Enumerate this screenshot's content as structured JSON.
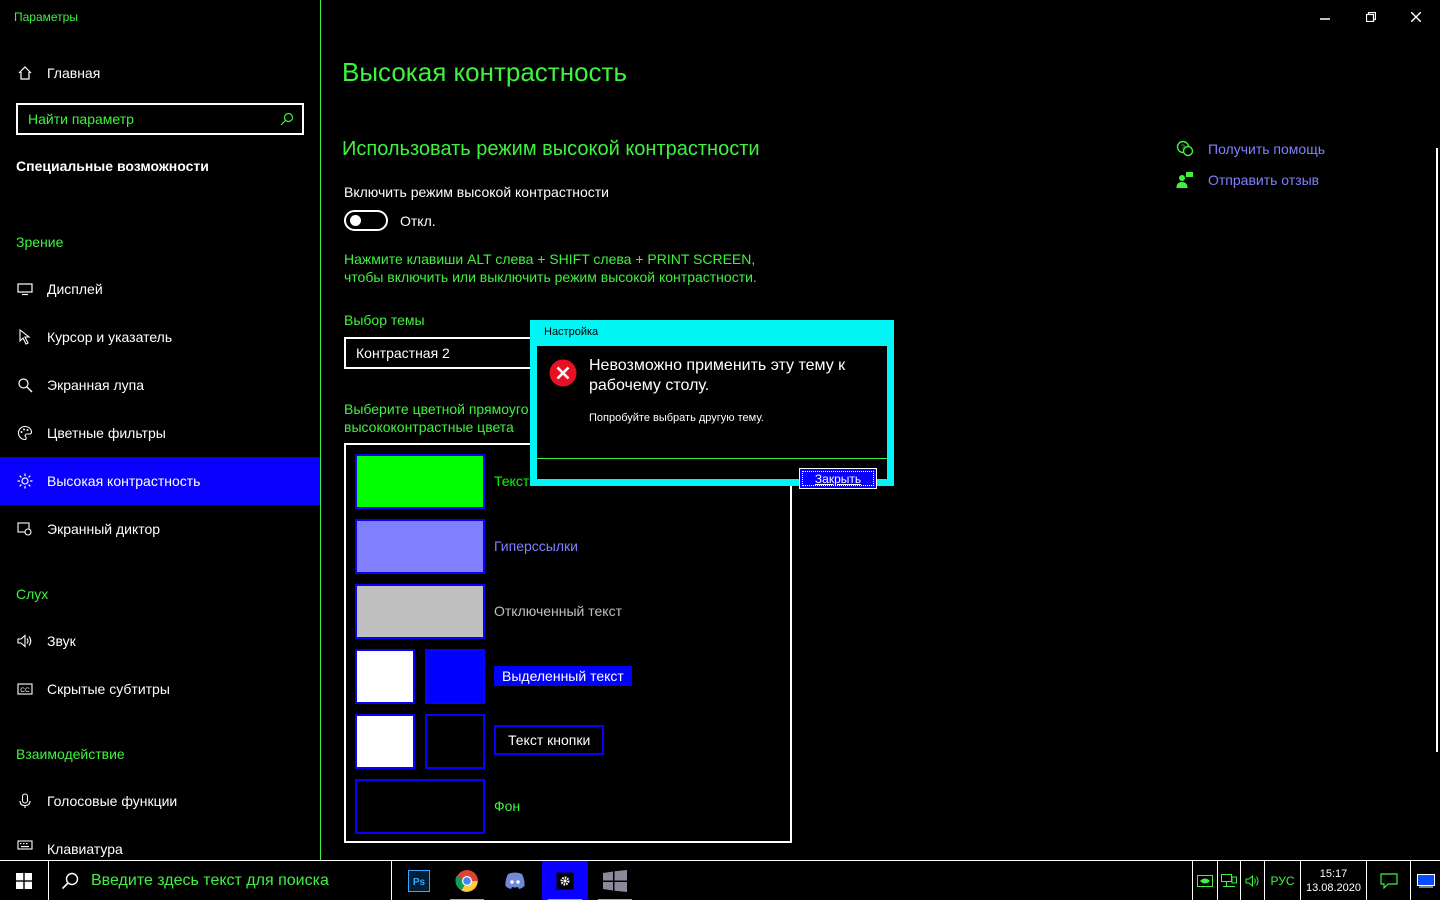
{
  "window": {
    "title": "Параметры",
    "minimize_icon": "minimize-icon",
    "restore_icon": "restore-icon",
    "close_icon": "close-icon"
  },
  "sidebar": {
    "home_label": "Главная",
    "search_placeholder": "Найти параметр",
    "section_title": "Специальные возможности",
    "groups": {
      "vision": "Зрение",
      "hearing": "Слух",
      "interaction": "Взаимодействие"
    },
    "items": {
      "display": "Дисплей",
      "cursor": "Курсор и указатель",
      "magnifier": "Экранная лупа",
      "color_filters": "Цветные фильтры",
      "high_contrast": "Высокая контрастность",
      "narrator": "Экранный диктор",
      "sound": "Звук",
      "captions": "Скрытые субтитры",
      "speech": "Голосовые функции",
      "keyboard": "Клавиатура"
    }
  },
  "main": {
    "page_title": "Высокая контрастность",
    "section_heading": "Использовать режим высокой контрастности",
    "toggle_caption": "Включить режим высокой контрастности",
    "toggle_state": "Откл.",
    "shortcut_hint": "Нажмите клавиши ALT слева + SHIFT слева + PRINT SCREEN, чтобы включить или выключить режим высокой контрастности.",
    "theme_caption": "Выбор темы",
    "theme_value": "Контрастная 2",
    "color_hint_line1": "Выберите цветной прямоуго",
    "color_hint_line2": "высококонтрастные цвета",
    "swatches": {
      "text": "Текст",
      "hyperlinks": "Гиперссылки",
      "disabled": "Отключенный текст",
      "selected": "Выделенный текст",
      "button_text": "Текст кнопки",
      "background": "Фон"
    }
  },
  "links": {
    "help": "Получить помощь",
    "feedback": "Отправить отзыв"
  },
  "dialog": {
    "title": "Настройка",
    "message": "Невозможно применить эту тему к рабочему столу.",
    "submessage": "Попробуйте выбрать другую тему.",
    "close_button": "Закрыть"
  },
  "taskbar": {
    "search_placeholder": "Введите здесь текст для поиска",
    "language": "РУС",
    "time": "15:17",
    "date": "13.08.2020"
  },
  "colors": {
    "accent_green": "#3ff23f",
    "accent_blue": "#0a00ff",
    "hyperlink": "#8080ff",
    "dialog_frame": "#00f5f5",
    "swatch_text": "#00ff00",
    "swatch_hyperlink": "#8080ff",
    "swatch_disabled": "#c0c0c0",
    "swatch_selected_bg": "#0000ff"
  }
}
